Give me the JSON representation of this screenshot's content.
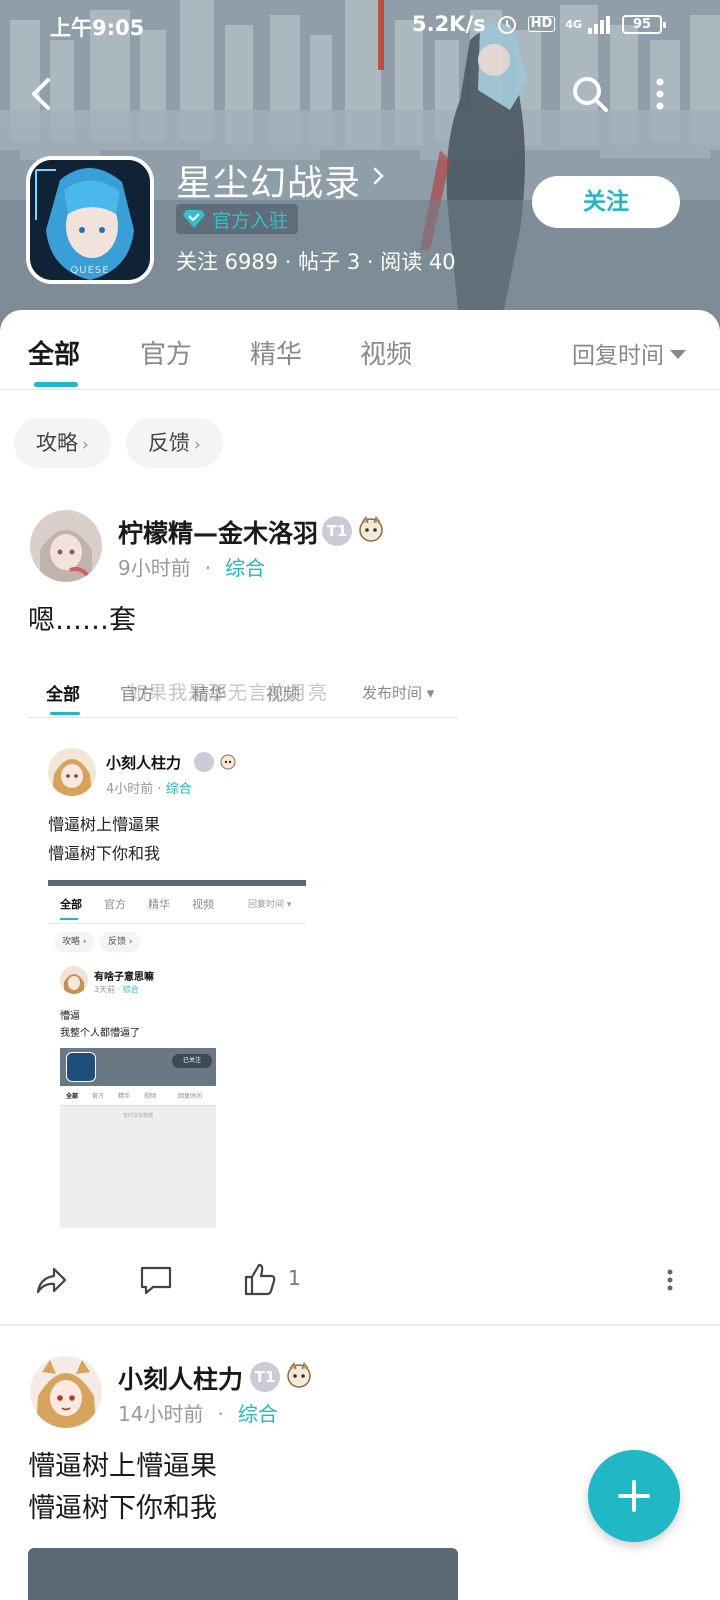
{
  "status_bar": {
    "time": "上午9:05",
    "speed": "5.2K/s",
    "hd": "HD",
    "network": "4G",
    "battery": "95"
  },
  "header": {
    "game_title": "星尘幻战录",
    "official_badge": "官方入驻",
    "stats": "关注 6989 · 帖子 3 · 阅读 40",
    "follow_label": "关注",
    "icon_caption": "QUESE"
  },
  "tabs": {
    "items": [
      {
        "label": "全部",
        "active": true
      },
      {
        "label": "官方",
        "active": false
      },
      {
        "label": "精华",
        "active": false
      },
      {
        "label": "视频",
        "active": false
      }
    ],
    "sort_label": "回复时间"
  },
  "filters": [
    {
      "label": "攻略"
    },
    {
      "label": "反馈"
    }
  ],
  "posts": [
    {
      "user": "柠檬精—金木洛羽",
      "level": "T1",
      "time": "9小时前",
      "category": "综合",
      "text": "嗯……套",
      "likes": "1",
      "embedded": {
        "overlay_text": "如果我是那无言的月亮",
        "tabs": [
          "全部",
          "官方",
          "精华",
          "视频"
        ],
        "sort_label": "发布时间",
        "user": "小刻人柱力",
        "time": "4小时前",
        "category": "综合",
        "text_lines": [
          "懵逼树上懵逼果",
          "懵逼树下你和我"
        ],
        "inner": {
          "tabs": [
            "全部",
            "官方",
            "精华",
            "视频"
          ],
          "sort_label": "回复时间",
          "chips": [
            "攻略",
            "反馈"
          ],
          "user": "有啥子意思嘛",
          "time": "3天前",
          "category": "综合",
          "text_lines": [
            "懵逼",
            "我整个人都懵逼了"
          ],
          "inner": {
            "follow_label": "已关注",
            "tabs": [
              "全部",
              "官方",
              "精华",
              "视频"
            ],
            "sort_label": "回复时间",
            "empty_text": "暂时没有数据"
          }
        }
      }
    },
    {
      "user": "小刻人柱力",
      "level": "T1",
      "time": "14小时前",
      "category": "综合",
      "text_lines": [
        "懵逼树上懵逼果",
        "懵逼树下你和我"
      ]
    }
  ],
  "colors": {
    "accent": "#20b8c4",
    "text": "#1a1a1a",
    "muted": "#8a8a8a"
  }
}
